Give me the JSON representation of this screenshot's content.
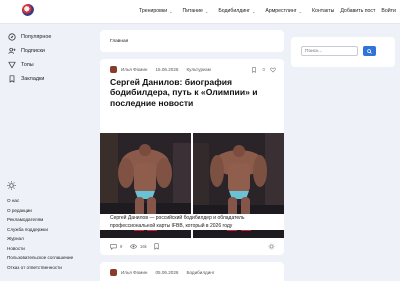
{
  "header": {
    "nav": [
      {
        "label": "Тренировки",
        "has_menu": true
      },
      {
        "label": "Питание",
        "has_menu": true
      },
      {
        "label": "Бодибилдинг",
        "has_menu": true
      },
      {
        "label": "Армрестлинг",
        "has_menu": true
      },
      {
        "label": "Контакты",
        "has_menu": false
      },
      {
        "label": "Добавить пост",
        "has_menu": false
      },
      {
        "label": "Войти",
        "has_menu": false
      }
    ]
  },
  "sidebar": {
    "items": [
      {
        "label": "Популярное",
        "icon": "compass-icon"
      },
      {
        "label": "Подписки",
        "icon": "person-add-icon"
      },
      {
        "label": "Топы",
        "icon": "trophy-icon"
      },
      {
        "label": "Закладки",
        "icon": "bookmark-icon"
      }
    ],
    "footer_links": [
      "О нас",
      "О редакции",
      "Рекламодателям",
      "Служба поддержки",
      "Журнал",
      "Новости",
      "Пользовательское соглашение",
      "Отказ от ответственности"
    ]
  },
  "breadcrumb": "Главная",
  "posts": [
    {
      "author": "Илья Фомин",
      "date": "15.06.2026",
      "category": "Культуризм",
      "bookmarks": "0",
      "title": "Сергей Данилов: биография бодибилдера, путь к «Олимпии» и последние новости",
      "excerpt": "Сергей Данилов — российский бодибилдер и обладатель профессиональной карты IFBB, который в 2026 году",
      "comments": "9",
      "views": "16k"
    },
    {
      "author": "Илья Фомин",
      "date": "05.06.2026",
      "category": "Бодибилдинг"
    }
  ],
  "search": {
    "placeholder": "Поиск..."
  },
  "colors": {
    "accent": "#2f74d6",
    "background": "#eef1f7"
  }
}
